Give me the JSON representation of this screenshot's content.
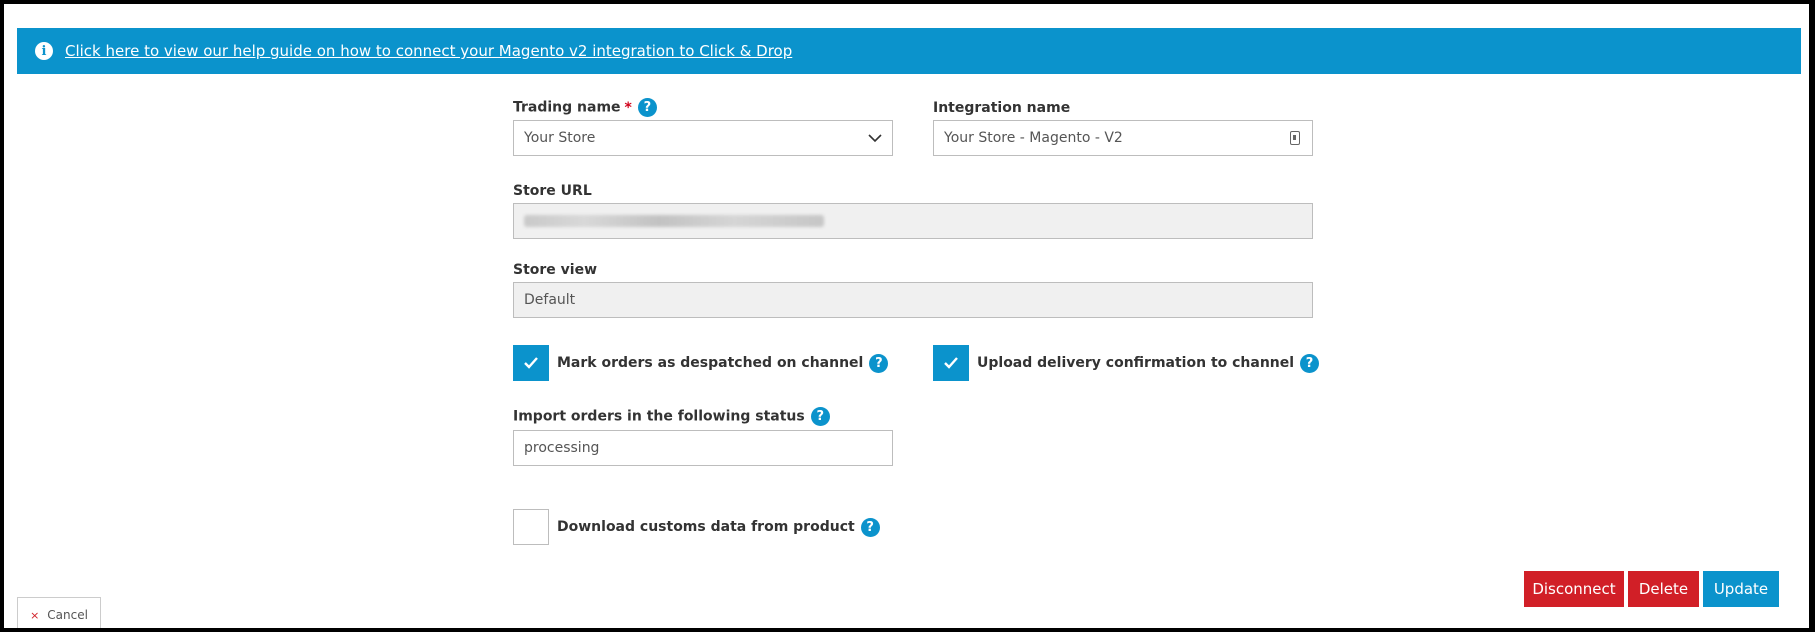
{
  "banner": {
    "link_text": "Click here to view our help guide on how to connect your Magento v2 integration to Click & Drop"
  },
  "form": {
    "trading_name": {
      "label": "Trading name",
      "required_mark": "*",
      "value": "Your Store"
    },
    "integration_name": {
      "label": "Integration name",
      "value": "Your Store - Magento - V2"
    },
    "store_url": {
      "label": "Store URL",
      "value": ""
    },
    "store_view": {
      "label": "Store view",
      "value": "Default"
    },
    "mark_despatched": {
      "label": "Mark orders as despatched on channel",
      "checked": true
    },
    "upload_delivery": {
      "label": "Upload delivery confirmation to channel",
      "checked": true
    },
    "import_status": {
      "label": "Import orders in the following status",
      "value": "processing"
    },
    "download_customs": {
      "label": "Download customs data from product",
      "checked": false
    }
  },
  "help_glyph": "?",
  "info_glyph": "i",
  "actions": {
    "disconnect_label": "Disconnect",
    "delete_label": "Delete",
    "update_label": "Update",
    "cancel_label": "Cancel",
    "cancel_glyph": "×"
  },
  "colors": {
    "accent": "#0b93cc",
    "danger": "#d11f27"
  }
}
